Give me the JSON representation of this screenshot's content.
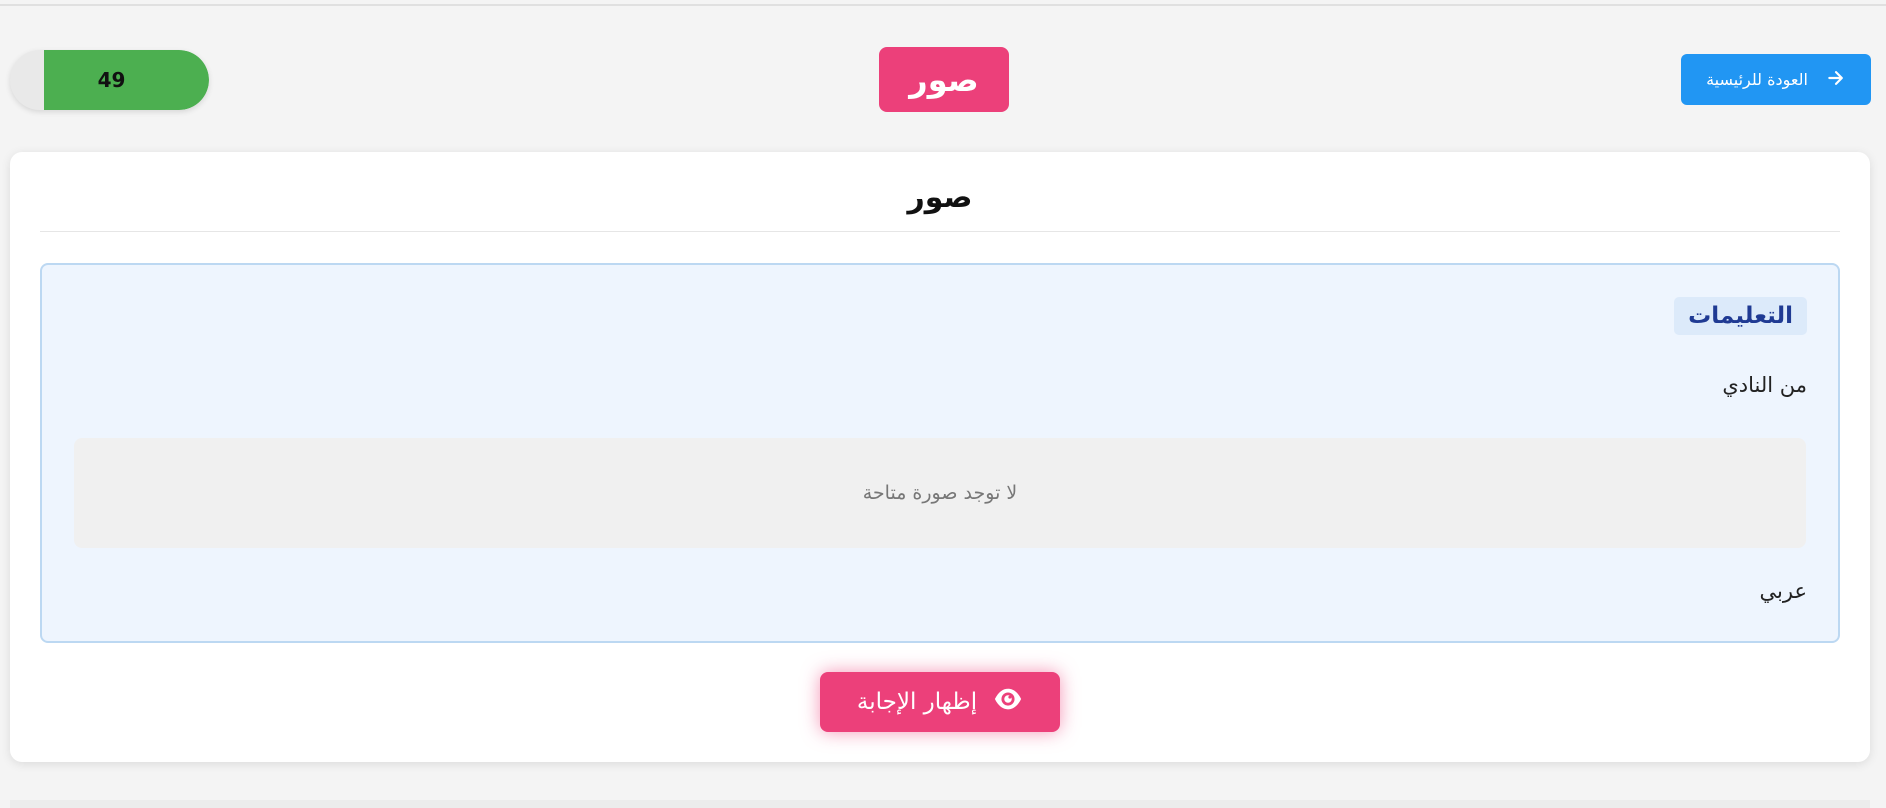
{
  "header": {
    "back_label": "العودة للرئيسية",
    "title": "صور",
    "score": "49",
    "score_fraction": 0.83
  },
  "card": {
    "title": "صور",
    "instructions": {
      "label": "التعليمات",
      "text": "من النادي",
      "no_image": "لا توجد صورة متاحة",
      "language": "عربي"
    },
    "show_answer_label": "إظهار الإجابة"
  },
  "colors": {
    "primary": "#2196f3",
    "accent": "#ec407a",
    "success": "#4caf50",
    "instructions_bg": "#eef5fe"
  },
  "icons": {
    "back": "arrow-right-icon",
    "show_answer": "eye-icon"
  }
}
